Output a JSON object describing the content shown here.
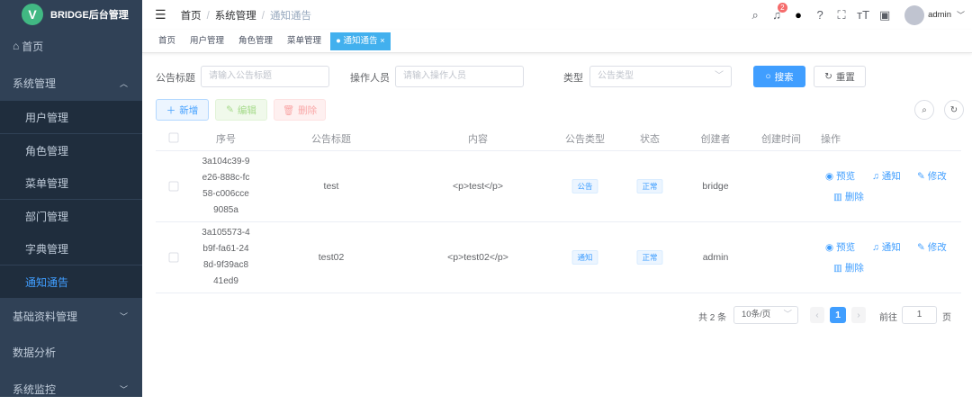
{
  "app": {
    "title": "BRIDGE后台管理",
    "logo_letter": "V"
  },
  "sidebar": {
    "items": [
      {
        "label": "首页",
        "icon": "home-icon"
      },
      {
        "label": "系统管理"
      },
      {
        "label": "用户管理"
      },
      {
        "label": "角色管理"
      },
      {
        "label": "菜单管理"
      },
      {
        "label": "部门管理"
      },
      {
        "label": "字典管理"
      },
      {
        "label": "通知通告"
      },
      {
        "label": "基础资料管理"
      },
      {
        "label": "数据分析"
      },
      {
        "label": "系统监控"
      }
    ]
  },
  "navbar": {
    "breadcrumb": [
      "首页",
      "系统管理",
      "通知通告"
    ],
    "notification_count": "2",
    "user": "admin",
    "active_color": "#409eff"
  },
  "tags": [
    "首页",
    "用户管理",
    "角色管理",
    "菜单管理",
    "通知通告"
  ],
  "search": {
    "title_label": "公告标题",
    "title_placeholder": "请输入公告标题",
    "operator_label": "操作人员",
    "operator_placeholder": "请输入操作人员",
    "type_label": "类型",
    "type_placeholder": "公告类型",
    "search_btn": "搜索",
    "reset_btn": "重置"
  },
  "toolbar": {
    "add": "新增",
    "edit": "编辑",
    "delete": "删除"
  },
  "table": {
    "headers": [
      "序号",
      "公告标题",
      "内容",
      "公告类型",
      "状态",
      "创建者",
      "创建时间",
      "操作"
    ],
    "rows": [
      {
        "id": "3a104c39-9\ne26-888c-fc\n58-c006cce\n9085a",
        "title": "test",
        "content": "<p>test</p>",
        "type": "公告",
        "status": "正常",
        "creator": "bridge",
        "created": ""
      },
      {
        "id": "3a105573-4\nb9f-fa61-24\n8d-9f39ac8\n41ed9",
        "title": "test02",
        "content": "<p>test02</p>",
        "type": "通知",
        "status": "正常",
        "creator": "admin",
        "created": ""
      }
    ],
    "actions": {
      "preview": "预览",
      "notify": "通知",
      "edit": "修改",
      "delete": "删除"
    }
  },
  "pagination": {
    "total": "共 2 条",
    "page_size": "10条/页",
    "current": "1",
    "goto_label": "前往",
    "goto_value": "1",
    "page_suffix": "页"
  }
}
